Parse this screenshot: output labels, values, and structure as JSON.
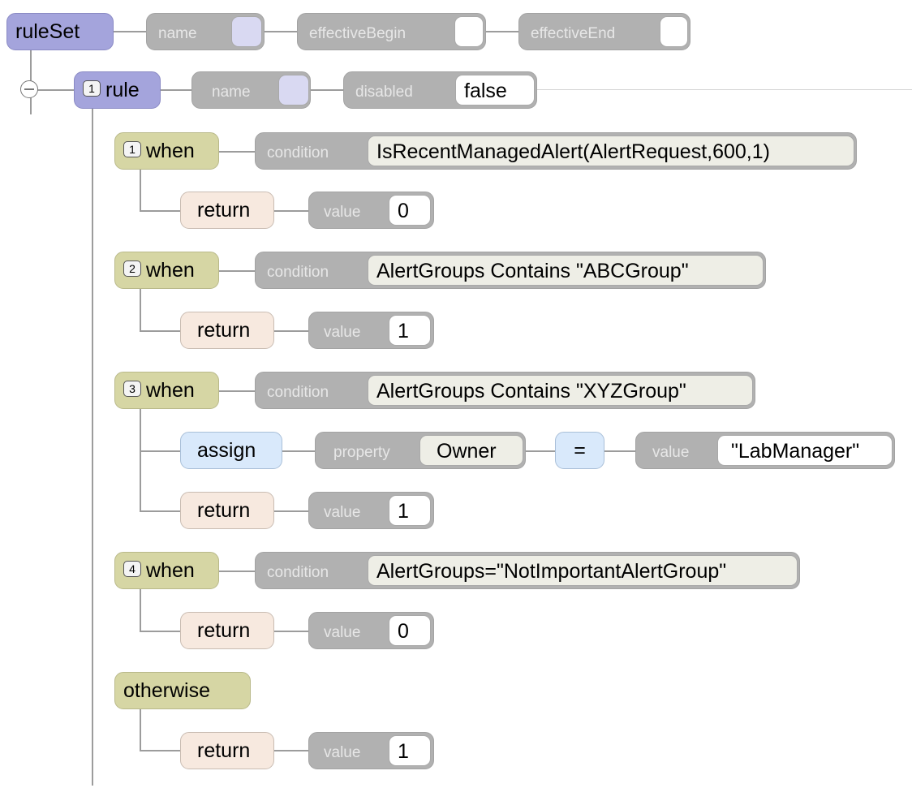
{
  "ruleset": {
    "label": "ruleSet",
    "attrs": {
      "name": "name",
      "effective_begin": "effectiveBegin",
      "effective_end": "effectiveEnd"
    }
  },
  "rule": {
    "index": "1",
    "label": "rule",
    "name_attr": "name",
    "disabled_attr": "disabled",
    "disabled_value": "false"
  },
  "whens": [
    {
      "index": "1",
      "label": "when",
      "condition_attr": "condition",
      "condition": "IsRecentManagedAlert(AlertRequest,600,1)",
      "return_label": "return",
      "value_attr": "value",
      "value": "0"
    },
    {
      "index": "2",
      "label": "when",
      "condition_attr": "condition",
      "condition": "AlertGroups Contains \"ABCGroup\"",
      "return_label": "return",
      "value_attr": "value",
      "value": "1"
    },
    {
      "index": "3",
      "label": "when",
      "condition_attr": "condition",
      "condition": "AlertGroups Contains \"XYZGroup\"",
      "return_label": "return",
      "value_attr": "value",
      "value": "1",
      "assign": {
        "label": "assign",
        "property_attr": "property",
        "property": "Owner",
        "operator": "=",
        "value_attr": "value",
        "value": "\"LabManager\""
      }
    },
    {
      "index": "4",
      "label": "when",
      "condition_attr": "condition",
      "condition": "AlertGroups=\"NotImportantAlertGroup\"",
      "return_label": "return",
      "value_attr": "value",
      "value": "0"
    }
  ],
  "otherwise": {
    "label": "otherwise",
    "return_label": "return",
    "value_attr": "value",
    "value": "1"
  }
}
